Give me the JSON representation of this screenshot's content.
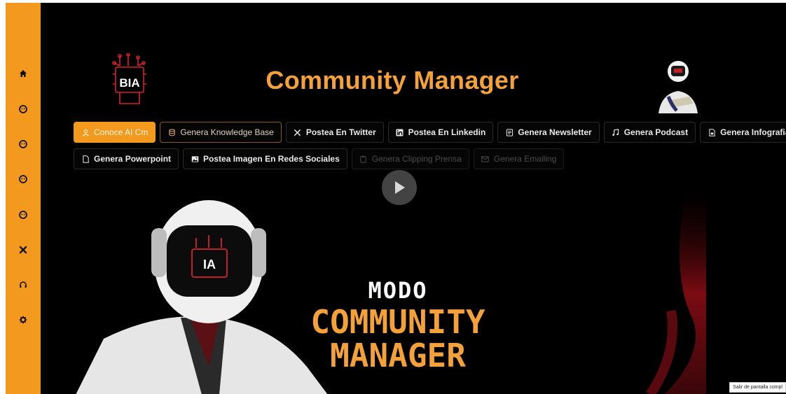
{
  "header": {
    "title": "Community Manager"
  },
  "logo": {
    "text": "BIA"
  },
  "buttons_row1": [
    {
      "label": "Conoce AI Cm",
      "icon": "person-icon",
      "state": "active"
    },
    {
      "label": "Genera Knowledge Base",
      "icon": "database-icon",
      "state": "outlined"
    },
    {
      "label": "Postea En Twitter",
      "icon": "x-twitter-icon",
      "state": "normal"
    },
    {
      "label": "Postea En Linkedin",
      "icon": "linkedin-icon",
      "state": "normal"
    },
    {
      "label": "Genera Newsletter",
      "icon": "newspaper-icon",
      "state": "normal"
    },
    {
      "label": "Genera Podcast",
      "icon": "music-note-icon",
      "state": "normal"
    },
    {
      "label": "Genera Infografia",
      "icon": "file-chart-icon",
      "state": "normal"
    }
  ],
  "buttons_row2": [
    {
      "label": "Genera Powerpoint",
      "icon": "file-icon",
      "state": "normal"
    },
    {
      "label": "Postea Imagen En Redes Sociales",
      "icon": "image-icon",
      "state": "normal"
    },
    {
      "label": "Genera Clipping Prensa",
      "icon": "clipboard-icon",
      "state": "disabled"
    },
    {
      "label": "Genera Emailing",
      "icon": "mail-icon",
      "state": "disabled"
    }
  ],
  "hero": {
    "line1": "MODO",
    "line2": "COMMUNITY",
    "line3": "MANAGER",
    "helmet_text": "IA"
  },
  "sidebar": {
    "items": [
      "home-icon",
      "face-icon",
      "face-icon",
      "face-icon",
      "face-icon",
      "tools-icon",
      "headset-icon",
      "gear-icon"
    ]
  },
  "exit_fullscreen": "Salir de pantalla compl",
  "colors": {
    "accent": "#f39a1e",
    "title": "#f4a13a",
    "background": "#000000"
  }
}
